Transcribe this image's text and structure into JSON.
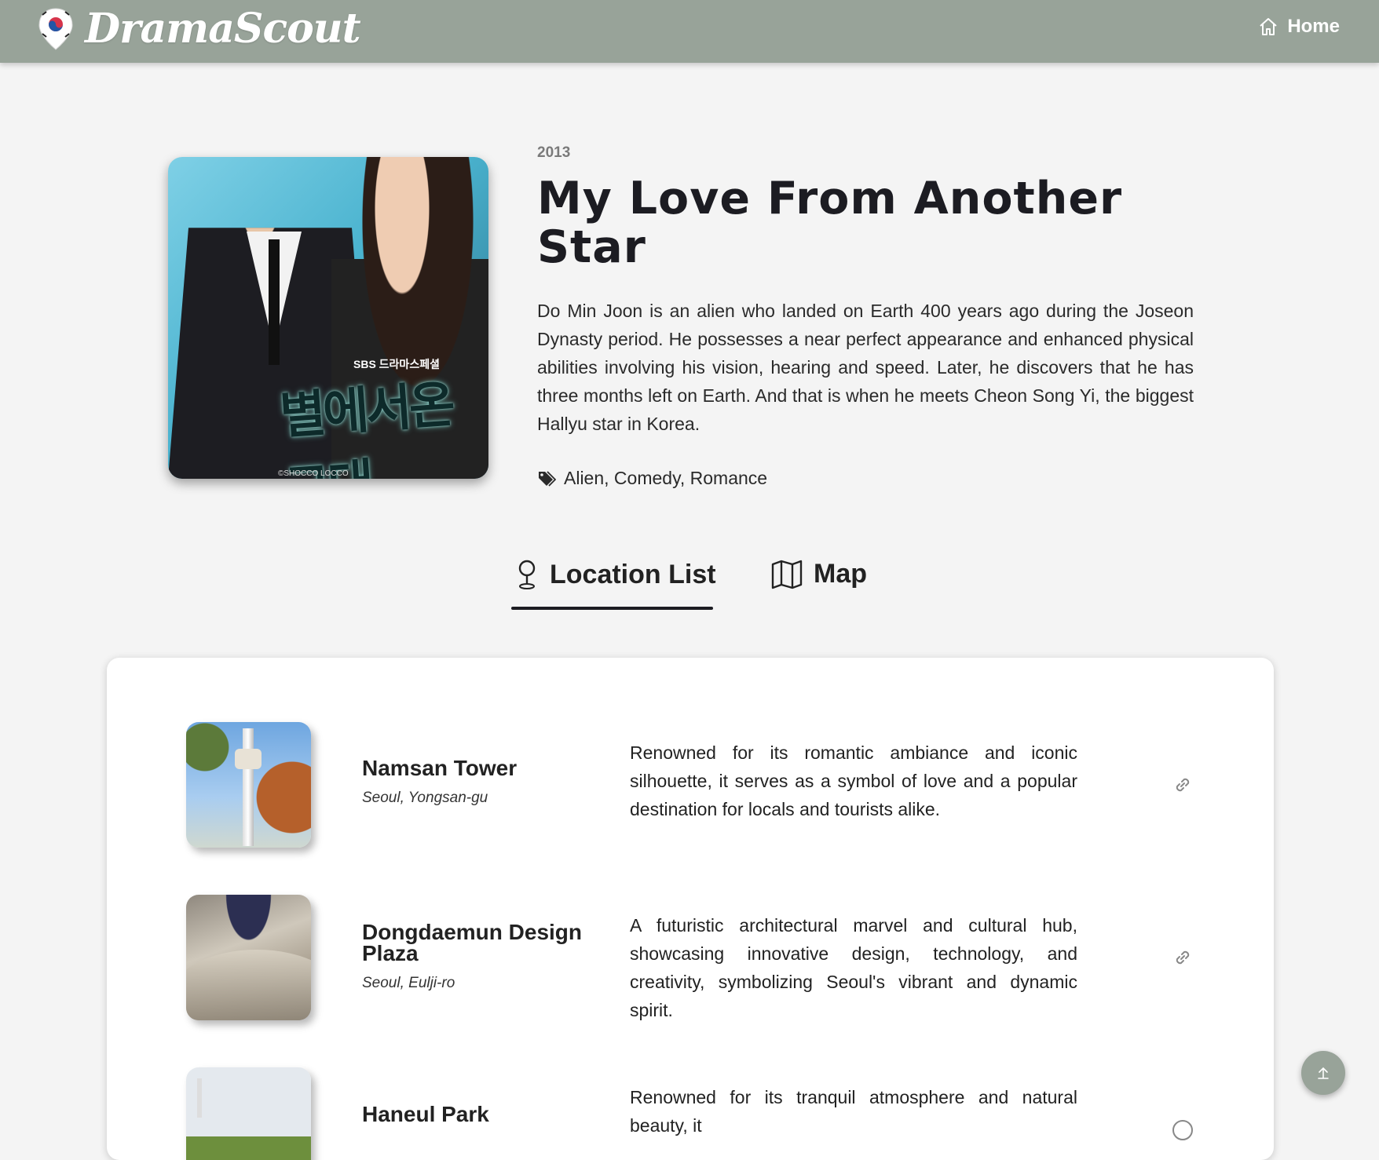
{
  "header": {
    "logo_text": "DramaScout",
    "home_label": "Home"
  },
  "drama": {
    "year": "2013",
    "title": "My Love From Another Star",
    "synopsis": "Do Min Joon is an alien who landed on Earth 400 years ago during the Joseon Dynasty period. He possesses a near perfect appearance and enhanced physical abilities involving his vision, hearing and speed. Later, he discovers that he has three months left on Earth. And that is when he meets Cheon Song Yi, the biggest Hallyu star in Korea.",
    "genres": "Alien, Comedy, Romance",
    "poster": {
      "network": "SBS 드라마스페셜",
      "title_korean": "별에서온 그대",
      "credit": "©SHOCCO LOCCO"
    }
  },
  "tabs": {
    "location_list": "Location List",
    "map": "Map",
    "active": "location_list"
  },
  "locations": [
    {
      "name": "Namsan Tower",
      "area": "Seoul, Yongsan-gu",
      "description": "Renowned for its romantic ambiance and iconic silhouette, it serves as a symbol of love and a popular destination for locals and tourists alike."
    },
    {
      "name": "Dongdaemun Design Plaza",
      "area": "Seoul, Eulji-ro",
      "description": "A futuristic architectural marvel and cultural hub, showcasing innovative design, technology, and creativity, symbolizing Seoul's vibrant and dynamic spirit."
    },
    {
      "name": "Haneul Park",
      "area": "",
      "description": "Renowned for its tranquil atmosphere and natural beauty, it"
    }
  ],
  "icons": {
    "logo": "korean-flag-pin-icon",
    "home": "home-icon",
    "genres": "tag-icon",
    "location_list": "map-pin-icon",
    "map": "folded-map-icon",
    "location_link": "link-icon",
    "back_to_top": "arrow-up-icon"
  },
  "colors": {
    "header_bg": "#98a399",
    "page_bg": "#f4f4f4",
    "text_dark": "#1c1c22"
  }
}
